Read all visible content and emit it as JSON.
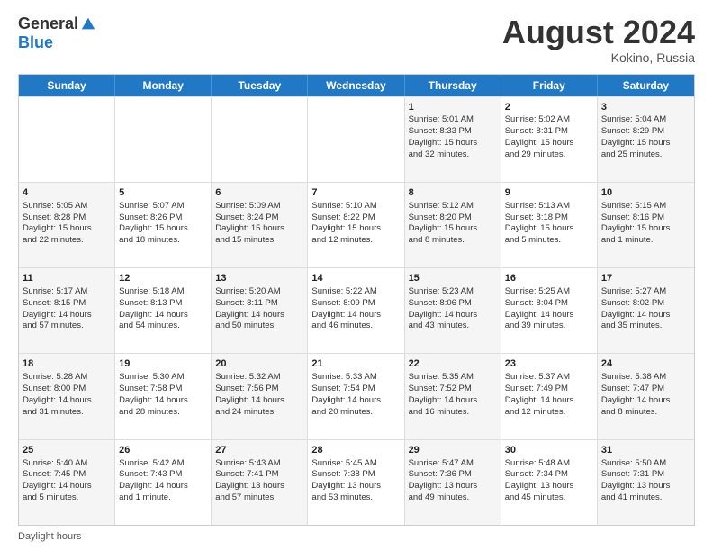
{
  "header": {
    "logo_general": "General",
    "logo_blue": "Blue",
    "month_title": "August 2024",
    "location": "Kokino, Russia"
  },
  "calendar": {
    "days_of_week": [
      "Sunday",
      "Monday",
      "Tuesday",
      "Wednesday",
      "Thursday",
      "Friday",
      "Saturday"
    ],
    "weeks": [
      [
        {
          "day": "",
          "content": ""
        },
        {
          "day": "",
          "content": ""
        },
        {
          "day": "",
          "content": ""
        },
        {
          "day": "",
          "content": ""
        },
        {
          "day": "1",
          "content": "Sunrise: 5:01 AM\nSunset: 8:33 PM\nDaylight: 15 hours\nand 32 minutes."
        },
        {
          "day": "2",
          "content": "Sunrise: 5:02 AM\nSunset: 8:31 PM\nDaylight: 15 hours\nand 29 minutes."
        },
        {
          "day": "3",
          "content": "Sunrise: 5:04 AM\nSunset: 8:29 PM\nDaylight: 15 hours\nand 25 minutes."
        }
      ],
      [
        {
          "day": "4",
          "content": "Sunrise: 5:05 AM\nSunset: 8:28 PM\nDaylight: 15 hours\nand 22 minutes."
        },
        {
          "day": "5",
          "content": "Sunrise: 5:07 AM\nSunset: 8:26 PM\nDaylight: 15 hours\nand 18 minutes."
        },
        {
          "day": "6",
          "content": "Sunrise: 5:09 AM\nSunset: 8:24 PM\nDaylight: 15 hours\nand 15 minutes."
        },
        {
          "day": "7",
          "content": "Sunrise: 5:10 AM\nSunset: 8:22 PM\nDaylight: 15 hours\nand 12 minutes."
        },
        {
          "day": "8",
          "content": "Sunrise: 5:12 AM\nSunset: 8:20 PM\nDaylight: 15 hours\nand 8 minutes."
        },
        {
          "day": "9",
          "content": "Sunrise: 5:13 AM\nSunset: 8:18 PM\nDaylight: 15 hours\nand 5 minutes."
        },
        {
          "day": "10",
          "content": "Sunrise: 5:15 AM\nSunset: 8:16 PM\nDaylight: 15 hours\nand 1 minute."
        }
      ],
      [
        {
          "day": "11",
          "content": "Sunrise: 5:17 AM\nSunset: 8:15 PM\nDaylight: 14 hours\nand 57 minutes."
        },
        {
          "day": "12",
          "content": "Sunrise: 5:18 AM\nSunset: 8:13 PM\nDaylight: 14 hours\nand 54 minutes."
        },
        {
          "day": "13",
          "content": "Sunrise: 5:20 AM\nSunset: 8:11 PM\nDaylight: 14 hours\nand 50 minutes."
        },
        {
          "day": "14",
          "content": "Sunrise: 5:22 AM\nSunset: 8:09 PM\nDaylight: 14 hours\nand 46 minutes."
        },
        {
          "day": "15",
          "content": "Sunrise: 5:23 AM\nSunset: 8:06 PM\nDaylight: 14 hours\nand 43 minutes."
        },
        {
          "day": "16",
          "content": "Sunrise: 5:25 AM\nSunset: 8:04 PM\nDaylight: 14 hours\nand 39 minutes."
        },
        {
          "day": "17",
          "content": "Sunrise: 5:27 AM\nSunset: 8:02 PM\nDaylight: 14 hours\nand 35 minutes."
        }
      ],
      [
        {
          "day": "18",
          "content": "Sunrise: 5:28 AM\nSunset: 8:00 PM\nDaylight: 14 hours\nand 31 minutes."
        },
        {
          "day": "19",
          "content": "Sunrise: 5:30 AM\nSunset: 7:58 PM\nDaylight: 14 hours\nand 28 minutes."
        },
        {
          "day": "20",
          "content": "Sunrise: 5:32 AM\nSunset: 7:56 PM\nDaylight: 14 hours\nand 24 minutes."
        },
        {
          "day": "21",
          "content": "Sunrise: 5:33 AM\nSunset: 7:54 PM\nDaylight: 14 hours\nand 20 minutes."
        },
        {
          "day": "22",
          "content": "Sunrise: 5:35 AM\nSunset: 7:52 PM\nDaylight: 14 hours\nand 16 minutes."
        },
        {
          "day": "23",
          "content": "Sunrise: 5:37 AM\nSunset: 7:49 PM\nDaylight: 14 hours\nand 12 minutes."
        },
        {
          "day": "24",
          "content": "Sunrise: 5:38 AM\nSunset: 7:47 PM\nDaylight: 14 hours\nand 8 minutes."
        }
      ],
      [
        {
          "day": "25",
          "content": "Sunrise: 5:40 AM\nSunset: 7:45 PM\nDaylight: 14 hours\nand 5 minutes."
        },
        {
          "day": "26",
          "content": "Sunrise: 5:42 AM\nSunset: 7:43 PM\nDaylight: 14 hours\nand 1 minute."
        },
        {
          "day": "27",
          "content": "Sunrise: 5:43 AM\nSunset: 7:41 PM\nDaylight: 13 hours\nand 57 minutes."
        },
        {
          "day": "28",
          "content": "Sunrise: 5:45 AM\nSunset: 7:38 PM\nDaylight: 13 hours\nand 53 minutes."
        },
        {
          "day": "29",
          "content": "Sunrise: 5:47 AM\nSunset: 7:36 PM\nDaylight: 13 hours\nand 49 minutes."
        },
        {
          "day": "30",
          "content": "Sunrise: 5:48 AM\nSunset: 7:34 PM\nDaylight: 13 hours\nand 45 minutes."
        },
        {
          "day": "31",
          "content": "Sunrise: 5:50 AM\nSunset: 7:31 PM\nDaylight: 13 hours\nand 41 minutes."
        }
      ]
    ]
  },
  "footer": {
    "label": "Daylight hours"
  }
}
